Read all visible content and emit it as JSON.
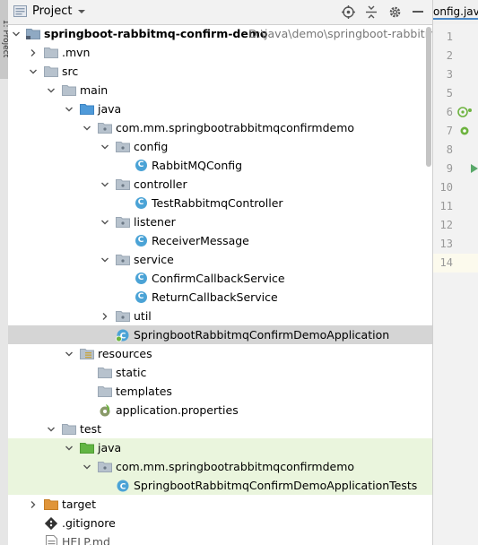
{
  "sidebar_tab": {
    "label": "1: Project"
  },
  "header": {
    "title": "Project"
  },
  "tree": {
    "root": {
      "name": "springboot-rabbitmq-confirm-demo",
      "path": "D:\\java\\demo\\springboot-rabbitm"
    },
    "mvn": ".mvn",
    "src": "src",
    "main": "main",
    "main_java": "java",
    "main_pkg": "com.mm.springbootrabbitmqconfirmdemo",
    "config": "config",
    "rabbit_config": "RabbitMQConfig",
    "controller": "controller",
    "test_controller": "TestRabbitmqController",
    "listener": "listener",
    "receiver": "ReceiverMessage",
    "service": "service",
    "confirm_service": "ConfirmCallbackService",
    "return_service": "ReturnCallbackService",
    "util": "util",
    "app": "SpringbootRabbitmqConfirmDemoApplication",
    "resources": "resources",
    "static": "static",
    "templates": "templates",
    "props": "application.properties",
    "test": "test",
    "test_java": "java",
    "test_pkg": "com.mm.springbootrabbitmqconfirmdemo",
    "app_tests": "SpringbootRabbitmqConfirmDemoApplicationTests",
    "target": "target",
    "gitignore": ".gitignore",
    "help": "HELP.md"
  },
  "editor": {
    "tab_label": "onfig.java",
    "line_numbers": [
      "1",
      "2",
      "3",
      "5",
      "6",
      "7",
      "8",
      "9",
      "10",
      "11",
      "12",
      "13",
      "14"
    ]
  }
}
